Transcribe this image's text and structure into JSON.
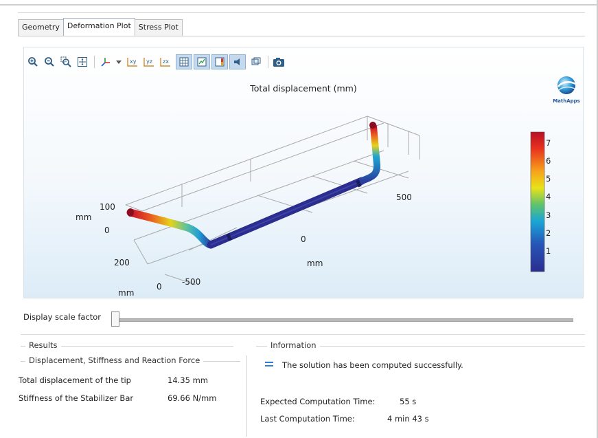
{
  "tabs": [
    {
      "label": "Geometry",
      "active": false
    },
    {
      "label": "Deformation Plot",
      "active": true
    },
    {
      "label": "Stress Plot",
      "active": false
    }
  ],
  "toolbar_icons": [
    "zoom-in-icon",
    "zoom-out-icon",
    "zoom-box-icon",
    "zoom-extents-icon",
    "axis-orientation-icon",
    "dropdown-arrow-icon",
    "xy-view-icon",
    "yz-view-icon",
    "zx-view-icon",
    "grid-toggle-icon",
    "axis-toggle-icon",
    "colorbar-toggle-icon",
    "light-toggle-icon",
    "transparency-icon",
    "snapshot-icon"
  ],
  "plot": {
    "title": "Total displacement (mm)",
    "logo_label": "MathApps",
    "axis_labels": {
      "z_tick_100": "100",
      "z_unit": "mm",
      "z_tick_0": "0",
      "y_tick_200": "200",
      "y_tick_0": "0",
      "y_unit": "mm",
      "x_tick_neg500": "-500",
      "x_tick_0": "0",
      "x_unit": "mm",
      "x_tick_500": "500"
    },
    "colorbar": {
      "ticks": [
        "7",
        "6",
        "5",
        "4",
        "3",
        "2",
        "1"
      ],
      "colors": [
        "#c8102e",
        "#e8331e",
        "#f7a21b",
        "#e9e21a",
        "#5fc36a",
        "#1aa6d6",
        "#2656b8",
        "#2b2d8f"
      ]
    }
  },
  "display_scale": {
    "label": "Display scale factor",
    "value": 0
  },
  "results": {
    "heading": "Results",
    "subheading": "Displacement, Stiffness and Reaction Force",
    "rows": [
      {
        "label": "Total displacement of the tip",
        "value": "14.35 mm"
      },
      {
        "label": "Stiffness of the Stabilizer Bar",
        "value": "69.66 N/mm"
      }
    ]
  },
  "information": {
    "heading": "Information",
    "message": "The solution has been computed successfully.",
    "rows": [
      {
        "label": "Expected Computation Time:",
        "value": "55 s"
      },
      {
        "label": "Last Computation Time:",
        "value": "4 min 43 s"
      }
    ]
  }
}
